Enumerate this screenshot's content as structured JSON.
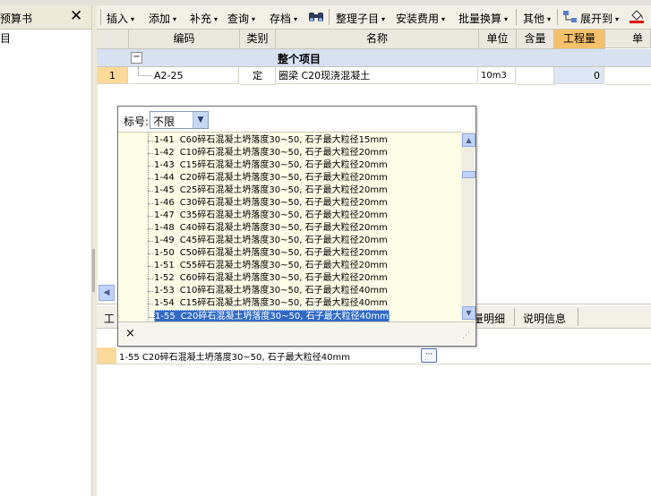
{
  "left_panel": {
    "title": "预算书",
    "close": "✕",
    "item": "目"
  },
  "toolbar": {
    "items": [
      {
        "label": "插入",
        "arrow": "▾"
      },
      {
        "label": "添加",
        "arrow": "▾"
      },
      {
        "label": "补充",
        "arrow": "▾"
      },
      {
        "label": "查询",
        "arrow": "▾"
      },
      {
        "label": "存档",
        "arrow": "▾"
      },
      {
        "label": "整理子目",
        "arrow": "▾"
      },
      {
        "label": "安装费用",
        "arrow": "▾"
      },
      {
        "label": "批量换算",
        "arrow": "▾"
      },
      {
        "label": "其他",
        "arrow": "▾"
      },
      {
        "label": "展开到",
        "arrow": "▾"
      }
    ]
  },
  "grid": {
    "headers": [
      "编码",
      "类别",
      "名称",
      "单位",
      "含量",
      "工程量",
      "单价"
    ],
    "group_toggle": "−",
    "group_label": "整个项目",
    "row": {
      "index": "1",
      "code": "A2-25",
      "type": "定",
      "name": "圈梁 C20现浇混凝土",
      "unit": "10m3",
      "qty": "0"
    }
  },
  "lower_tabs": {
    "partial_left": "工",
    "partial_mid": "量明细",
    "desc": "说明信息"
  },
  "lower_row": {
    "text": "1-55  C20碎石混凝土坍落度30~50, 石子最大粒径40mm",
    "ellipsis": "···"
  },
  "popup": {
    "filter_label": "标号:",
    "filter_value": "不限",
    "close": "×",
    "items": [
      {
        "code": "1-41",
        "desc": "C60碎石混凝土坍落度30~50, 石子最大粒径15mm"
      },
      {
        "code": "1-42",
        "desc": "C10碎石混凝土坍落度30~50, 石子最大粒径20mm"
      },
      {
        "code": "1-43",
        "desc": "C15碎石混凝土坍落度30~50, 石子最大粒径20mm"
      },
      {
        "code": "1-44",
        "desc": "C20碎石混凝土坍落度30~50, 石子最大粒径20mm"
      },
      {
        "code": "1-45",
        "desc": "C25碎石混凝土坍落度30~50, 石子最大粒径20mm"
      },
      {
        "code": "1-46",
        "desc": "C30碎石混凝土坍落度30~50, 石子最大粒径20mm"
      },
      {
        "code": "1-47",
        "desc": "C35碎石混凝土坍落度30~50, 石子最大粒径20mm"
      },
      {
        "code": "1-48",
        "desc": "C40碎石混凝土坍落度30~50, 石子最大粒径20mm"
      },
      {
        "code": "1-49",
        "desc": "C45碎石混凝土坍落度30~50, 石子最大粒径20mm"
      },
      {
        "code": "1-50",
        "desc": "C50碎石混凝土坍落度30~50, 石子最大粒径20mm"
      },
      {
        "code": "1-51",
        "desc": "C55碎石混凝土坍落度30~50, 石子最大粒径20mm"
      },
      {
        "code": "1-52",
        "desc": "C60碎石混凝土坍落度30~50, 石子最大粒径20mm"
      },
      {
        "code": "1-53",
        "desc": "C10碎石混凝土坍落度30~50, 石子最大粒径40mm"
      },
      {
        "code": "1-54",
        "desc": "C15碎石混凝土坍落度30~50, 石子最大粒径40mm"
      },
      {
        "code": "1-55",
        "desc": "C20碎石混凝土坍落度30~50, 石子最大粒径40mm",
        "selected": true
      }
    ]
  },
  "colors": {
    "selection": "#316ac5",
    "list_bg": "#fdfce7",
    "row_index_bg": "#fbd99b",
    "qty_bg": "#dde6f4"
  }
}
